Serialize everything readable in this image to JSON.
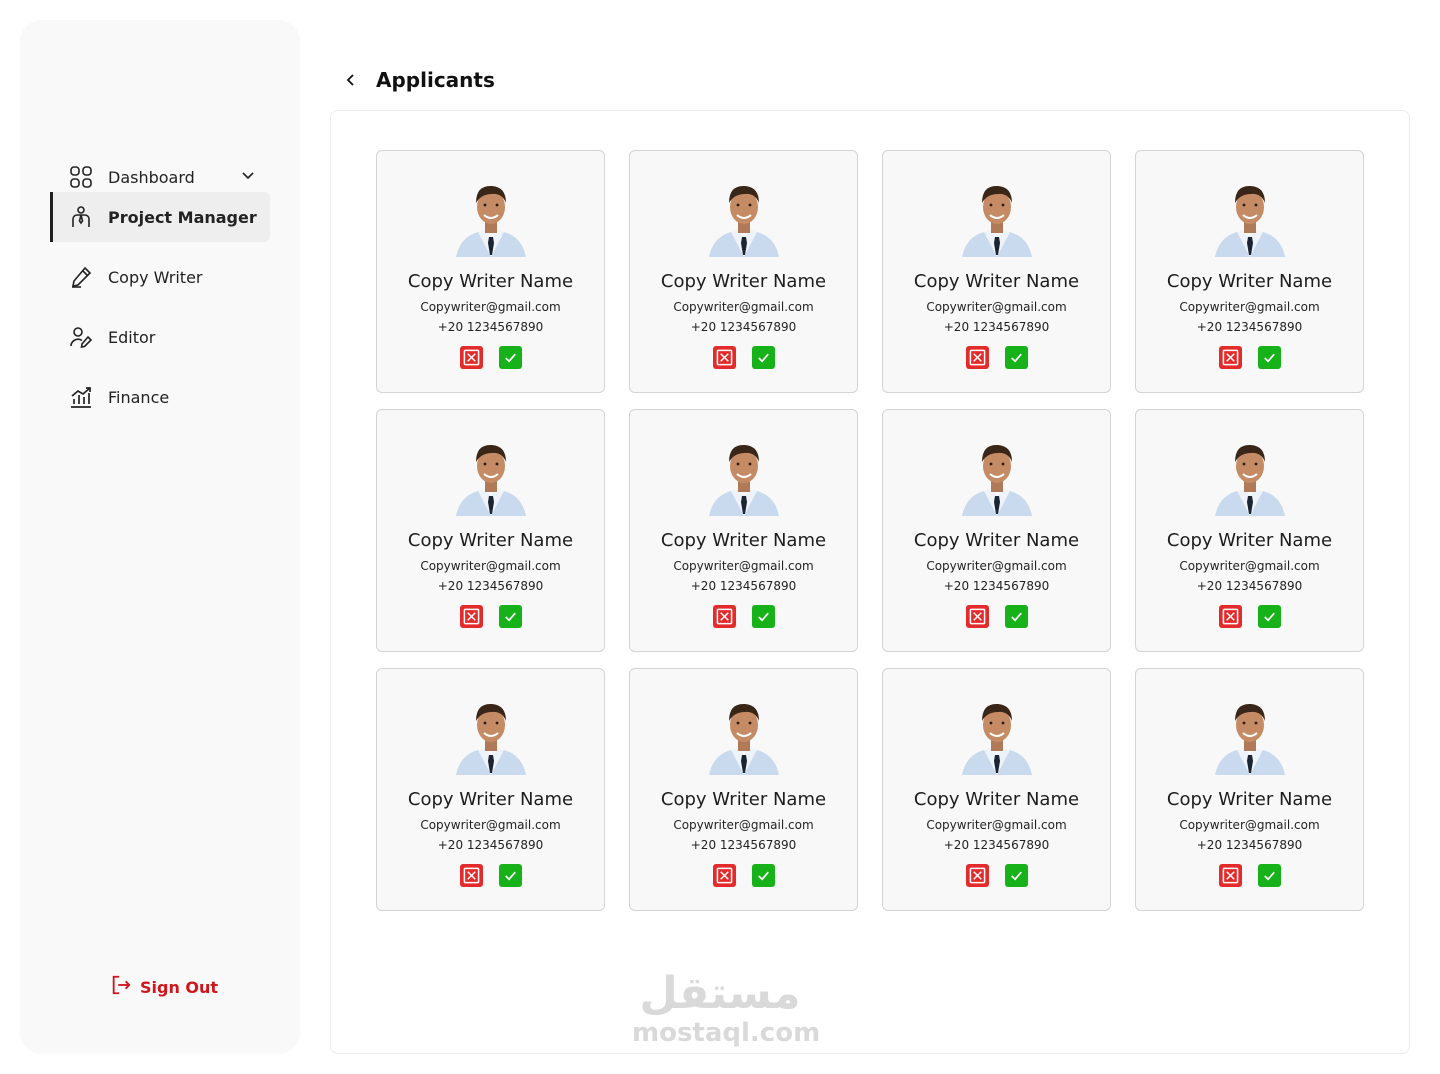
{
  "sidebar": {
    "items": [
      {
        "label": "Dashboard",
        "icon": "grid-icon",
        "expandable": true,
        "active": false
      },
      {
        "label": "Project Manager",
        "icon": "manager-icon",
        "active": true
      },
      {
        "label": "Copy Writer",
        "icon": "pen-icon",
        "active": false
      },
      {
        "label": "Editor",
        "icon": "user-edit-icon",
        "active": false
      },
      {
        "label": "Finance",
        "icon": "chart-icon",
        "active": false
      }
    ],
    "signout_label": "Sign Out"
  },
  "header": {
    "title": "Applicants"
  },
  "applicants": [
    {
      "name": "Copy Writer Name",
      "email": "Copywriter@gmail.com",
      "phone": "+20 1234567890"
    },
    {
      "name": "Copy Writer Name",
      "email": "Copywriter@gmail.com",
      "phone": "+20 1234567890"
    },
    {
      "name": "Copy Writer Name",
      "email": "Copywriter@gmail.com",
      "phone": "+20 1234567890"
    },
    {
      "name": "Copy Writer Name",
      "email": "Copywriter@gmail.com",
      "phone": "+20 1234567890"
    },
    {
      "name": "Copy Writer Name",
      "email": "Copywriter@gmail.com",
      "phone": "+20 1234567890"
    },
    {
      "name": "Copy Writer Name",
      "email": "Copywriter@gmail.com",
      "phone": "+20 1234567890"
    },
    {
      "name": "Copy Writer Name",
      "email": "Copywriter@gmail.com",
      "phone": "+20 1234567890"
    },
    {
      "name": "Copy Writer Name",
      "email": "Copywriter@gmail.com",
      "phone": "+20 1234567890"
    },
    {
      "name": "Copy Writer Name",
      "email": "Copywriter@gmail.com",
      "phone": "+20 1234567890"
    },
    {
      "name": "Copy Writer Name",
      "email": "Copywriter@gmail.com",
      "phone": "+20 1234567890"
    },
    {
      "name": "Copy Writer Name",
      "email": "Copywriter@gmail.com",
      "phone": "+20 1234567890"
    },
    {
      "name": "Copy Writer Name",
      "email": "Copywriter@gmail.com",
      "phone": "+20 1234567890"
    }
  ],
  "colors": {
    "reject": "#e32b2b",
    "accept": "#17b21a",
    "signout": "#d0161d"
  },
  "watermark": {
    "arabic": "مستقل",
    "latin": "mostaql.com"
  }
}
